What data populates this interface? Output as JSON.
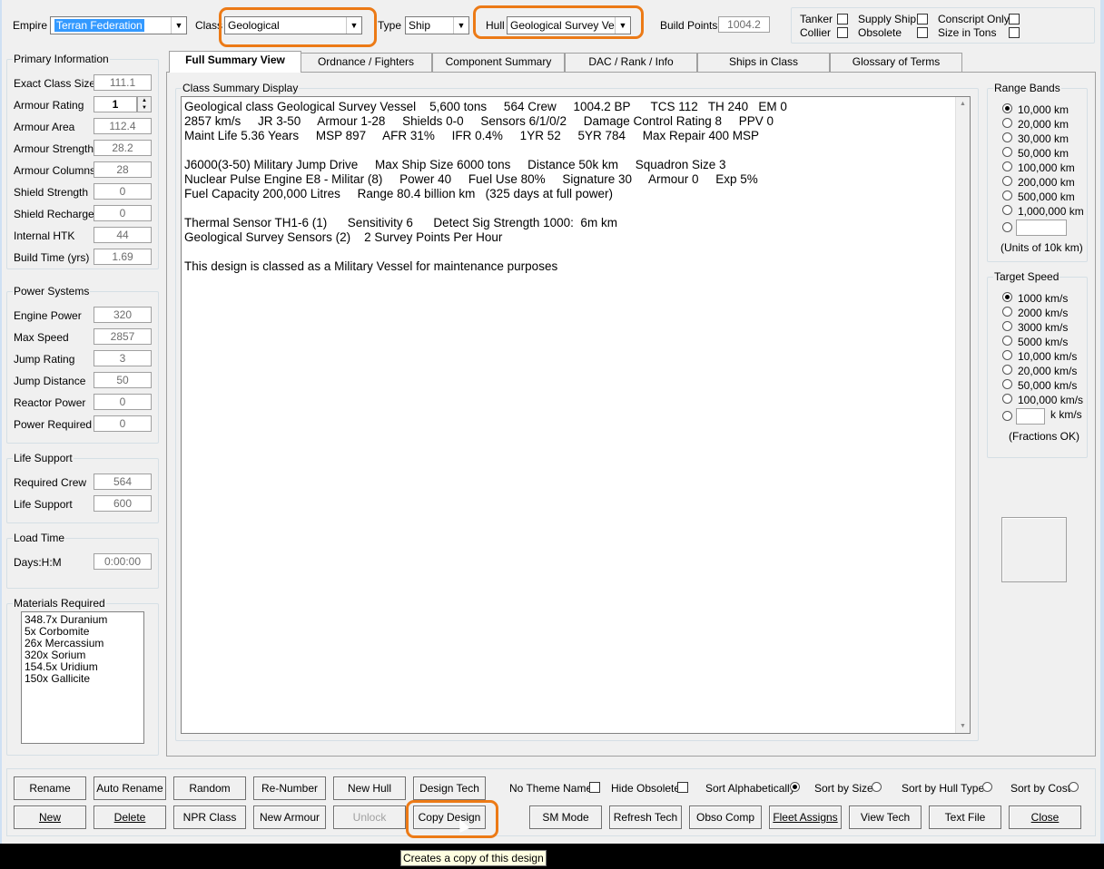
{
  "header": {
    "empire_label": "Empire",
    "empire_value": "Terran Federation",
    "class_label": "Class",
    "class_value": "Geological",
    "type_label": "Type",
    "type_value": "Ship",
    "hull_label": "Hull",
    "hull_value": "Geological Survey Vessel",
    "build_points_label": "Build Points",
    "build_points_value": "1004.2"
  },
  "flags": [
    {
      "label": "Tanker"
    },
    {
      "label": "Supply Ship"
    },
    {
      "label": "Conscript Only"
    },
    {
      "label": "Collier"
    },
    {
      "label": "Obsolete"
    },
    {
      "label": "Size in Tons"
    }
  ],
  "primary": {
    "title": "Primary Information",
    "rows": [
      {
        "label": "Exact Class Size",
        "value": "111.1"
      },
      {
        "label": "Armour Rating",
        "value": "1"
      },
      {
        "label": "Armour Area",
        "value": "112.4"
      },
      {
        "label": "Armour Strength",
        "value": "28.2"
      },
      {
        "label": "Armour Columns",
        "value": "28"
      },
      {
        "label": "Shield Strength",
        "value": "0"
      },
      {
        "label": "Shield Recharge",
        "value": "0"
      },
      {
        "label": "Internal HTK",
        "value": "44"
      },
      {
        "label": "Build Time (yrs)",
        "value": "1.69"
      }
    ]
  },
  "power": {
    "title": "Power Systems",
    "rows": [
      {
        "label": "Engine Power",
        "value": "320"
      },
      {
        "label": "Max Speed",
        "value": "2857"
      },
      {
        "label": "Jump Rating",
        "value": "3"
      },
      {
        "label": "Jump Distance",
        "value": "50"
      },
      {
        "label": "Reactor Power",
        "value": "0"
      },
      {
        "label": "Power Required",
        "value": "0"
      }
    ]
  },
  "life": {
    "title": "Life Support",
    "rows": [
      {
        "label": "Required Crew",
        "value": "564"
      },
      {
        "label": "Life Support",
        "value": "600"
      }
    ]
  },
  "load": {
    "title": "Load Time",
    "rows": [
      {
        "label": "Days:H:M",
        "value": "0:00:00"
      }
    ]
  },
  "materials": {
    "title": "Materials Required",
    "items": [
      "348.7x Duranium",
      "5x Corbomite",
      "26x Mercassium",
      "320x Sorium",
      "154.5x Uridium",
      "150x Gallicite"
    ]
  },
  "tabs": [
    "Full Summary View",
    "Ordnance / Fighters",
    "Component Summary",
    "DAC / Rank / Info",
    "Ships in Class",
    "Glossary of Terms"
  ],
  "summary": {
    "title": "Class Summary Display",
    "lines": [
      "Geological class Geological Survey Vessel    5,600 tons     564 Crew     1004.2 BP      TCS 112   TH 240   EM 0",
      "2857 km/s     JR 3-50     Armour 1-28     Shields 0-0     Sensors 6/1/0/2     Damage Control Rating 8     PPV 0",
      "Maint Life 5.36 Years     MSP 897     AFR 31%     IFR 0.4%     1YR 52     5YR 784     Max Repair 400 MSP",
      "",
      "J6000(3-50) Military Jump Drive     Max Ship Size 6000 tons     Distance 50k km     Squadron Size 3",
      "Nuclear Pulse Engine E8 - Militar (8)     Power 40     Fuel Use 80%     Signature 30     Armour 0     Exp 5%",
      "Fuel Capacity 200,000 Litres     Range 80.4 billion km   (325 days at full power)",
      "",
      "Thermal Sensor TH1-6 (1)      Sensitivity 6      Detect Sig Strength 1000:  6m km",
      "Geological Survey Sensors (2)    2 Survey Points Per Hour",
      "",
      "This design is classed as a Military Vessel for maintenance purposes"
    ]
  },
  "range_bands": {
    "title": "Range Bands",
    "options": [
      "10,000 km",
      "20,000 km",
      "30,000 km",
      "50,000 km",
      "100,000 km",
      "200,000 km",
      "500,000 km",
      "1,000,000 km"
    ],
    "note": "(Units of 10k km)"
  },
  "target_speed": {
    "title": "Target Speed",
    "options": [
      "1000 km/s",
      "2000 km/s",
      "3000 km/s",
      "5000 km/s",
      "10,000 km/s",
      "20,000 km/s",
      "50,000 km/s",
      "100,000 km/s"
    ],
    "unit": "k km/s",
    "note": "(Fractions OK)"
  },
  "buttons_row1": [
    "Rename",
    "Auto Rename",
    "Random Name",
    "Re-Number",
    "New Hull",
    "Design Tech"
  ],
  "buttons_row2": [
    "New",
    "Delete",
    "NPR Class",
    "New Armour",
    "Unlock",
    "Copy Design",
    "SM Mode",
    "Refresh Tech",
    "Obso Comp",
    "Fleet Assigns",
    "View Tech",
    "Text File",
    "Close"
  ],
  "options_row": {
    "no_theme": "No Theme Name",
    "hide_obsolete": "Hide Obsolete",
    "sort_alpha": "Sort Alphabetically",
    "sort_size": "Sort by Size",
    "sort_hull": "Sort by Hull Type",
    "sort_cost": "Sort by Cost"
  },
  "tooltip": "Creates a copy of this design",
  "accent_color": "#ec7a16"
}
